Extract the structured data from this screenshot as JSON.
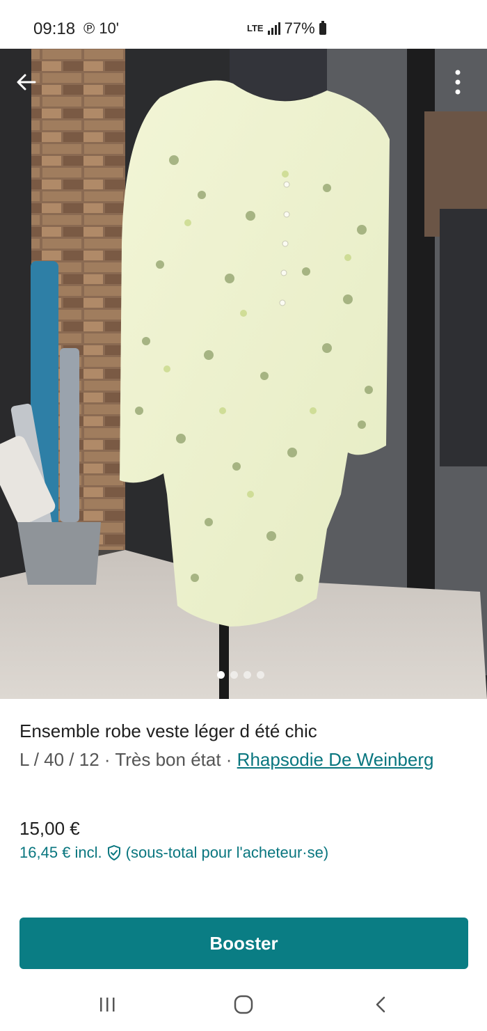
{
  "status_bar": {
    "time": "09:18",
    "notification": "℗ 10'",
    "lte": "LTE",
    "battery": "77%"
  },
  "photo": {
    "icons": {
      "back": "arrow-left-icon",
      "menu": "more-vert-icon"
    },
    "carousel_count": 4,
    "carousel_active": 1
  },
  "listing": {
    "title": "Ensemble robe veste léger d été chic",
    "size": "L / 40 / 12",
    "separator": " · ",
    "condition": "Très bon état",
    "brand": "Rhapsodie De Weinberg",
    "price": "15,00 €",
    "price_incl": "16,45 € incl.",
    "price_note": "(sous-total pour l'acheteur·se)"
  },
  "actions": {
    "booster_label": "Booster"
  },
  "colors": {
    "accent": "#0a7d84",
    "link": "#09767f"
  },
  "navbar": {
    "icons": [
      "recent-apps-icon",
      "home-icon",
      "back-icon"
    ]
  }
}
